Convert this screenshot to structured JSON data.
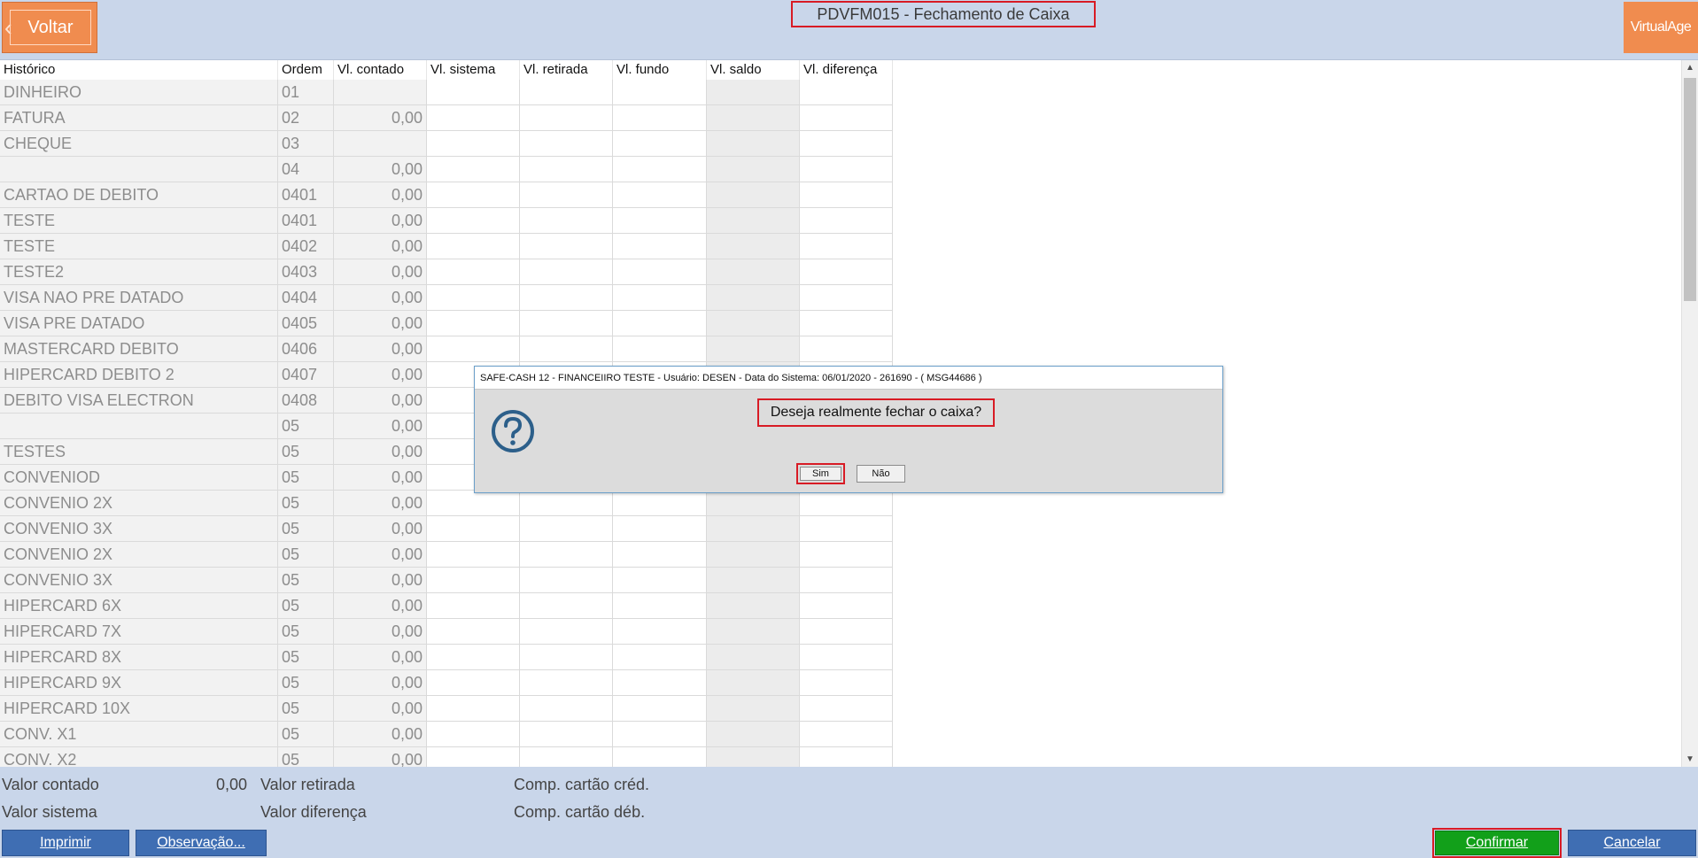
{
  "header": {
    "back_label": "Voltar",
    "title": "PDVFM015 - Fechamento de Caixa",
    "brand": "VirtualAge"
  },
  "grid": {
    "columns": [
      "Histórico",
      "Ordem",
      "Vl. contado",
      "Vl. sistema",
      "Vl. retirada",
      "Vl. fundo",
      "Vl. saldo",
      "Vl. diferença"
    ],
    "rows": [
      {
        "hist": "DINHEIRO",
        "ord": "01",
        "cont": ""
      },
      {
        "hist": "FATURA",
        "ord": "02",
        "cont": "0,00"
      },
      {
        "hist": "CHEQUE",
        "ord": "03",
        "cont": ""
      },
      {
        "hist": "",
        "ord": "04",
        "cont": "0,00"
      },
      {
        "hist": "CARTAO DE DEBITO",
        "ord": "0401",
        "cont": "0,00"
      },
      {
        "hist": "TESTE",
        "ord": "0401",
        "cont": "0,00"
      },
      {
        "hist": "TESTE",
        "ord": "0402",
        "cont": "0,00"
      },
      {
        "hist": "TESTE2",
        "ord": "0403",
        "cont": "0,00"
      },
      {
        "hist": "VISA NAO PRE DATADO",
        "ord": "0404",
        "cont": "0,00"
      },
      {
        "hist": "VISA PRE DATADO",
        "ord": "0405",
        "cont": "0,00"
      },
      {
        "hist": "MASTERCARD DEBITO",
        "ord": "0406",
        "cont": "0,00"
      },
      {
        "hist": "HIPERCARD DEBITO 2",
        "ord": "0407",
        "cont": "0,00"
      },
      {
        "hist": "DEBITO VISA ELECTRON",
        "ord": "0408",
        "cont": "0,00"
      },
      {
        "hist": "",
        "ord": "05",
        "cont": "0,00"
      },
      {
        "hist": "TESTES",
        "ord": "05",
        "cont": "0,00"
      },
      {
        "hist": "CONVENIOD",
        "ord": "05",
        "cont": "0,00"
      },
      {
        "hist": "CONVENIO 2X",
        "ord": "05",
        "cont": "0,00"
      },
      {
        "hist": "CONVENIO 3X",
        "ord": "05",
        "cont": "0,00"
      },
      {
        "hist": "CONVENIO 2X",
        "ord": "05",
        "cont": "0,00"
      },
      {
        "hist": "CONVENIO 3X",
        "ord": "05",
        "cont": "0,00"
      },
      {
        "hist": "HIPERCARD 6X",
        "ord": "05",
        "cont": "0,00"
      },
      {
        "hist": "HIPERCARD 7X",
        "ord": "05",
        "cont": "0,00"
      },
      {
        "hist": "HIPERCARD 8X",
        "ord": "05",
        "cont": "0,00"
      },
      {
        "hist": "HIPERCARD 9X",
        "ord": "05",
        "cont": "0,00"
      },
      {
        "hist": "HIPERCARD 10X",
        "ord": "05",
        "cont": "0,00"
      },
      {
        "hist": "CONV. X1",
        "ord": "05",
        "cont": "0,00"
      },
      {
        "hist": "CONV. X2",
        "ord": "05",
        "cont": "0,00"
      }
    ]
  },
  "footer": {
    "valor_contado_label": "Valor contado",
    "valor_contado_value": "0,00",
    "valor_sistema_label": "Valor sistema",
    "valor_retirada_label": "Valor retirada",
    "valor_diferenca_label": "Valor diferença",
    "comp_cred_label": "Comp. cartão créd.",
    "comp_deb_label": "Comp. cartão déb.",
    "print_label": "Imprimir",
    "obs_label": "Observação...",
    "confirm_label": "Confirmar",
    "cancel_label": "Cancelar"
  },
  "dialog": {
    "title": "SAFE-CASH 12 - FINANCEIIRO TESTE - Usuário: DESEN - Data do Sistema: 06/01/2020 - 261690 - ( MSG44686 )",
    "message": "Deseja realmente fechar o caixa?",
    "yes_label": "Sim",
    "no_label": "Não",
    "icon": "question-icon"
  },
  "colors": {
    "header_bg": "#c9d6ea",
    "orange": "#f08c4f",
    "highlight": "#d81b25",
    "confirm": "#12a01a",
    "button_blue": "#3f6eb3"
  }
}
